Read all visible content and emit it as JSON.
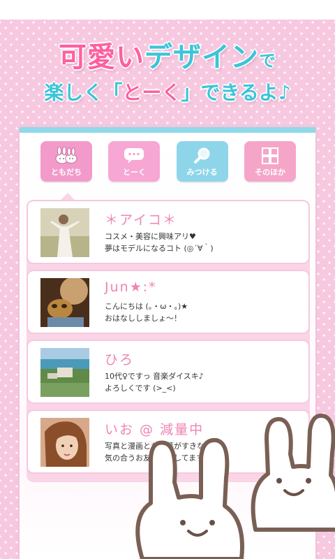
{
  "hero": {
    "line1_a": "可愛い",
    "line1_b": "デザイン",
    "line1_c": "で",
    "line2_a": "楽しく「",
    "line2_b": "とーく",
    "line2_c": "」できるよ♪"
  },
  "tabs": [
    {
      "label": "ともだち",
      "icon": "friends-icon"
    },
    {
      "label": "とーく",
      "icon": "chat-bubble-icon"
    },
    {
      "label": "みつける",
      "icon": "search-icon"
    },
    {
      "label": "そのほか",
      "icon": "grid-icon"
    }
  ],
  "users": [
    {
      "name": "＊アイコ＊",
      "line1": "コスメ・美容に興味アリ♥",
      "line2": "夢はモデルになるコト (◎´∀｀)"
    },
    {
      "name": "Jun★:*",
      "line1": "こんにちは (。・ω・。)★",
      "line2": "おはなししましょ〜！"
    },
    {
      "name": "ひろ",
      "line1": "10代♀ですっ 音楽ダイスキ♪",
      "line2": "よろしくです (>_<)"
    },
    {
      "name": "いお @ 減量中",
      "line1": "写真と漫画とお洒落がすきな JK",
      "line2": "気の合うお友達募集してます！"
    }
  ],
  "colors": {
    "background": "#f7c9e0",
    "accent_pink": "#ff5fa0",
    "accent_cyan": "#3cc4d8",
    "name_pink": "#ef84b4"
  }
}
